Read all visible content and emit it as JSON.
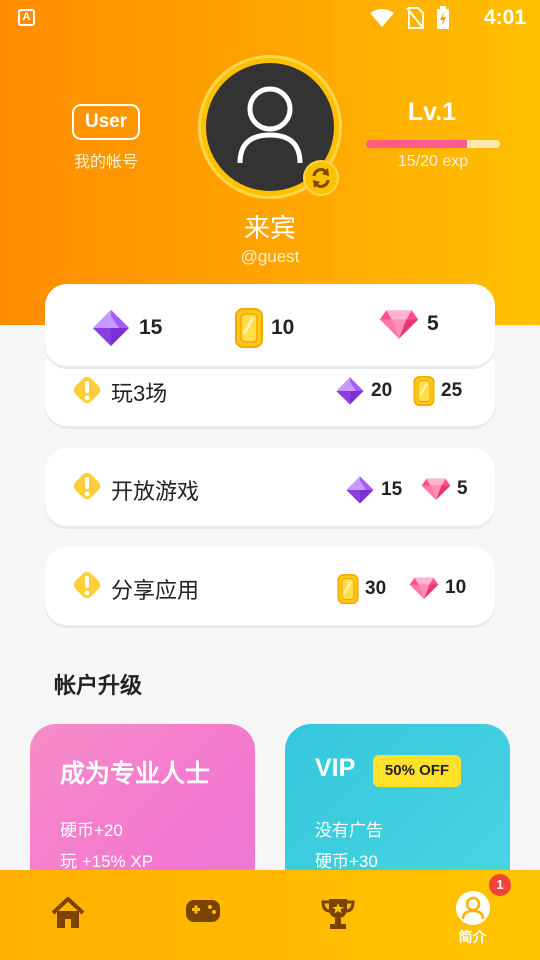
{
  "status_bar": {
    "time": "4:01",
    "app_icon": "A"
  },
  "profile": {
    "user_tag": "User",
    "account_label": "我的帐号",
    "name": "来宾",
    "handle": "@guest",
    "level": "Lv.1",
    "exp_text": "15/20 exp",
    "exp_progress": 0.75
  },
  "wallet": {
    "purple_gems": "15",
    "coins": "10",
    "pink_gems": "5"
  },
  "tasks": [
    {
      "title": "玩3场",
      "rewards": [
        {
          "type": "purple-gem",
          "value": "20"
        },
        {
          "type": "coin",
          "value": "25"
        }
      ]
    },
    {
      "title": "开放游戏",
      "rewards": [
        {
          "type": "purple-gem",
          "value": "15"
        },
        {
          "type": "pink-gem",
          "value": "5"
        }
      ]
    },
    {
      "title": "分享应用",
      "rewards": [
        {
          "type": "coin",
          "value": "30"
        },
        {
          "type": "pink-gem",
          "value": "10"
        }
      ]
    }
  ],
  "upgrade": {
    "section_title": "帐户升级",
    "pro": {
      "title": "成为专业人士",
      "line1": "硬币+20",
      "line2": "玩 +15% XP"
    },
    "vip": {
      "title": "VIP",
      "badge": "50% OFF",
      "line1": "没有广告",
      "line2": "硬币+30"
    }
  },
  "bottom_nav": {
    "items": [
      {
        "icon": "home-icon"
      },
      {
        "icon": "gamepad-icon"
      },
      {
        "icon": "trophy-icon"
      },
      {
        "icon": "profile-icon",
        "label": "简介",
        "badge": "1",
        "active": true
      }
    ]
  },
  "colors": {
    "orange": "#ff8c00",
    "yellow": "#ffc000",
    "purple_gem": "#8a3fe0",
    "pink_gem": "#ff4f8f",
    "coin": "#ffc81a"
  }
}
